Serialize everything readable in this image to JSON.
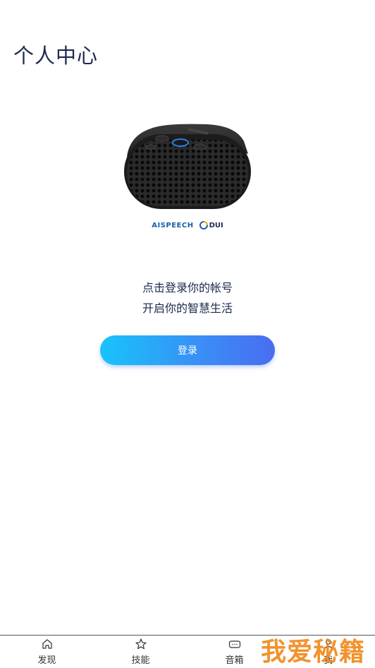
{
  "header": {
    "title": "个人中心"
  },
  "brand": {
    "aispeech": "AISPEECH",
    "dui": "DUI"
  },
  "prompt": {
    "line1": "点击登录你的帐号",
    "line2": "开启你的智慧生活"
  },
  "login": {
    "label": "登录"
  },
  "tabbar": {
    "items": [
      {
        "label": "发现",
        "icon": "home-icon"
      },
      {
        "label": "技能",
        "icon": "star-icon"
      },
      {
        "label": "音箱",
        "icon": "speaker-icon"
      },
      {
        "label": "我",
        "icon": "user-icon",
        "active": true
      }
    ]
  },
  "watermark": {
    "text": "我爱秘籍"
  },
  "colors": {
    "accent_start": "#19c3fb",
    "accent_end": "#4a6df0",
    "title": "#1d2a4d"
  }
}
